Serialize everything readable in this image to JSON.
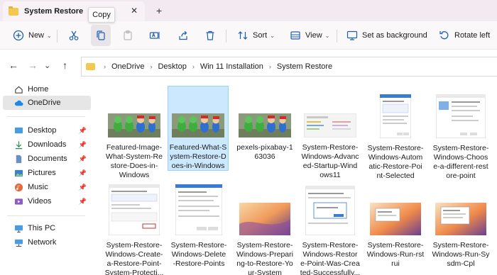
{
  "tab": {
    "title": "System Restore",
    "close": "✕",
    "new": "+"
  },
  "tooltip": "Copy",
  "toolbar": {
    "new_label": "New",
    "sort_label": "Sort",
    "view_label": "View",
    "set_bg_label": "Set as background",
    "rotate_label": "Rotate left"
  },
  "address": {
    "crumbs": [
      "OneDrive",
      "Desktop",
      "Win 11 Installation",
      "System Restore"
    ]
  },
  "sidebar": {
    "items": [
      {
        "label": "Home"
      },
      {
        "label": "OneDrive"
      },
      {
        "label": "Desktop"
      },
      {
        "label": "Downloads"
      },
      {
        "label": "Documents"
      },
      {
        "label": "Pictures"
      },
      {
        "label": "Music"
      },
      {
        "label": "Videos"
      },
      {
        "label": "This PC"
      },
      {
        "label": "Network"
      }
    ]
  },
  "files": [
    {
      "name": "Featured-Image-What-System-Restore-Does-in-Windows"
    },
    {
      "name": "Featured-What-System-Restore-Does-in-Windows"
    },
    {
      "name": "pexels-pixabay-163036"
    },
    {
      "name": "System-Restore-Windows-Advanced-Startup-Windows11"
    },
    {
      "name": "System-Restore-Windows-Automatic-Restore-Point-Selected"
    },
    {
      "name": "System-Restore-Windows-Choose-a-different-restore-point"
    },
    {
      "name": "System-Restore-Windows-Create-a-Restore-Point-System-Protecti..."
    },
    {
      "name": "System-Restore-Windows-Delete-Restore-Points"
    },
    {
      "name": "System-Restore-Windows-Preparing-to-Restore-Your-System"
    },
    {
      "name": "System-Restore-Windows-Restore-Point-Was-Created-Successfully..."
    },
    {
      "name": "System-Restore-Windows-Run-rstrui"
    },
    {
      "name": "System-Restore-Windows-Run-Sysdm-Cpl"
    }
  ],
  "file_captions": [
    [
      "Featured-Image-",
      "What-System-Re",
      "store-Does-in-",
      "Windows"
    ],
    [
      "Featured-What-S",
      "ystem-Restore-D",
      "oes-in-Windows"
    ],
    [
      "pexels-pixabay-1",
      "63036"
    ],
    [
      "System-Restore-",
      "Windows-Advanc",
      "ed-Startup-Wind",
      "ows11"
    ],
    [
      "System-Restore-",
      "Windows-Autom",
      "atic-Restore-Poi",
      "nt-Selected"
    ],
    [
      "System-Restore-",
      "Windows-Choos",
      "e-a-different-rest",
      "ore-point"
    ],
    [
      "System-Restore-",
      "Windows-Create-",
      "a-Restore-Point-",
      "System-Protecti..."
    ],
    [
      "System-Restore-",
      "Windows-Delete",
      "-Restore-Points"
    ],
    [
      "System-Restore-",
      "Windows-Prepari",
      "ng-to-Restore-Yo",
      "ur-System"
    ],
    [
      "System-Restore-",
      "Windows-Restor",
      "e-Point-Was-Crea",
      "ted-Successfully..."
    ],
    [
      "System-Restore-",
      "Windows-Run-rst",
      "rui"
    ],
    [
      "System-Restore-",
      "Windows-Run-Sy",
      "sdm-Cpl"
    ]
  ],
  "colors": {
    "accent": "#0067c0",
    "selection": "#cce8ff",
    "folder": "#f2c94c"
  }
}
